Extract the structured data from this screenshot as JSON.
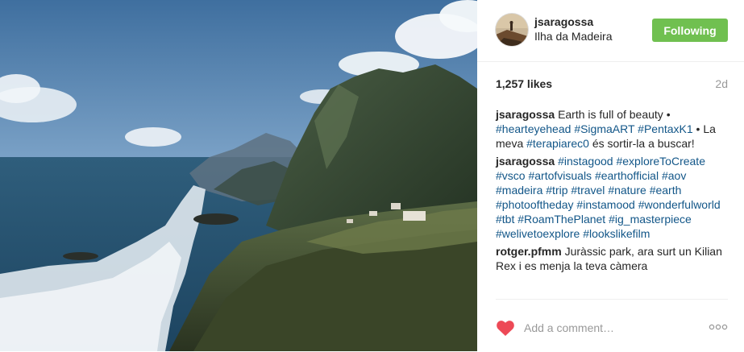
{
  "post": {
    "username": "jsaragossa",
    "location": "Ilha da Madeira",
    "follow_label": "Following",
    "likes": "1,257 likes",
    "time_ago": "2d"
  },
  "caption": {
    "user": "jsaragossa",
    "segments": [
      {
        "text": "Earth is full of beauty • ",
        "type": "text"
      },
      {
        "text": "#hearteyehead",
        "type": "tag"
      },
      {
        "text": " ",
        "type": "text"
      },
      {
        "text": "#SigmaART",
        "type": "tag"
      },
      {
        "text": " ",
        "type": "text"
      },
      {
        "text": "#PentaxK1",
        "type": "tag"
      },
      {
        "text": " • La meva ",
        "type": "text"
      },
      {
        "text": "#terapiarec0",
        "type": "tag"
      },
      {
        "text": " és sortir-la a buscar!",
        "type": "text"
      }
    ]
  },
  "comments": [
    {
      "user": "jsaragossa",
      "segments": [
        {
          "text": "#instagood",
          "type": "tag"
        },
        {
          "text": " ",
          "type": "text"
        },
        {
          "text": "#exploreToCreate",
          "type": "tag"
        },
        {
          "text": " ",
          "type": "text"
        },
        {
          "text": "#vsco",
          "type": "tag"
        },
        {
          "text": " ",
          "type": "text"
        },
        {
          "text": "#artofvisuals",
          "type": "tag"
        },
        {
          "text": " ",
          "type": "text"
        },
        {
          "text": "#earthofficial",
          "type": "tag"
        },
        {
          "text": " ",
          "type": "text"
        },
        {
          "text": "#aov",
          "type": "tag"
        },
        {
          "text": " ",
          "type": "text"
        },
        {
          "text": "#madeira",
          "type": "tag"
        },
        {
          "text": " ",
          "type": "text"
        },
        {
          "text": "#trip",
          "type": "tag"
        },
        {
          "text": " ",
          "type": "text"
        },
        {
          "text": "#travel",
          "type": "tag"
        },
        {
          "text": " ",
          "type": "text"
        },
        {
          "text": "#nature",
          "type": "tag"
        },
        {
          "text": " ",
          "type": "text"
        },
        {
          "text": "#earth",
          "type": "tag"
        },
        {
          "text": " ",
          "type": "text"
        },
        {
          "text": "#photooftheday",
          "type": "tag"
        },
        {
          "text": " ",
          "type": "text"
        },
        {
          "text": "#instamood",
          "type": "tag"
        },
        {
          "text": " ",
          "type": "text"
        },
        {
          "text": "#wonderfulworld",
          "type": "tag"
        },
        {
          "text": " ",
          "type": "text"
        },
        {
          "text": "#tbt",
          "type": "tag"
        },
        {
          "text": " ",
          "type": "text"
        },
        {
          "text": "#RoamThePlanet",
          "type": "tag"
        },
        {
          "text": " ",
          "type": "text"
        },
        {
          "text": "#ig_masterpiece",
          "type": "tag"
        },
        {
          "text": " ",
          "type": "text"
        },
        {
          "text": "#welivetoexplore",
          "type": "tag"
        },
        {
          "text": " ",
          "type": "text"
        },
        {
          "text": "#lookslikefilm",
          "type": "tag"
        }
      ]
    },
    {
      "user": "rotger.pfmm",
      "segments": [
        {
          "text": "Juràssic park, ara surt un Kilian Rex i es menja la teva càmera",
          "type": "text"
        }
      ]
    }
  ],
  "footer": {
    "comment_placeholder": "Add a comment…",
    "like_icon": "heart-icon",
    "more_icon": "more-options-icon"
  },
  "colors": {
    "follow_button": "#70c050",
    "hashtag": "#125688",
    "heart": "#ed4956",
    "muted": "#999999"
  }
}
